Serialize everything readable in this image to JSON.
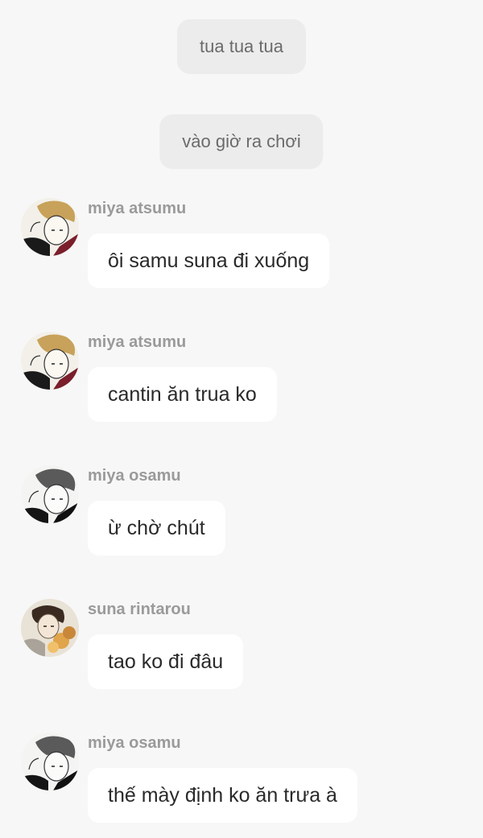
{
  "system_messages": [
    {
      "text": "tua tua tua"
    },
    {
      "text": "vào giờ ra chơi"
    }
  ],
  "messages": [
    {
      "sender": "miya atsumu",
      "text": "ôi samu suna đi xuống",
      "avatar_icon": "atsumu-avatar-icon"
    },
    {
      "sender": "miya atsumu",
      "text": "cantin ăn trua ko",
      "avatar_icon": "atsumu-avatar-icon"
    },
    {
      "sender": "miya osamu",
      "text": "ừ chờ chút",
      "avatar_icon": "osamu-avatar-icon"
    },
    {
      "sender": "suna rintarou",
      "text": "tao ko đi đâu",
      "avatar_icon": "suna-avatar-icon"
    },
    {
      "sender": "miya osamu",
      "text": "thế mày định ko ăn trưa à",
      "avatar_icon": "osamu-avatar-icon"
    }
  ],
  "colors": {
    "background": "#f7f7f7",
    "bubble": "#ffffff",
    "system_pill": "#ececec",
    "sender_name": "#9a9a9a",
    "message_text": "#2a2a2a"
  }
}
